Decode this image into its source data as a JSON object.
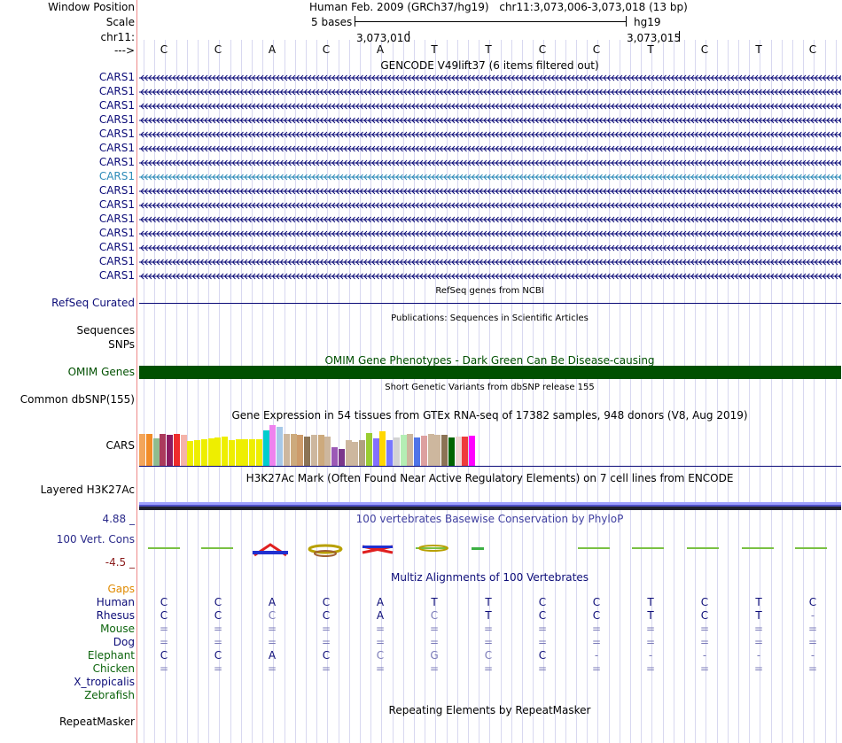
{
  "header": {
    "labels": {
      "window_position": "Window Position",
      "scale": "Scale",
      "chrom": "chr11:",
      "strand": "--->"
    },
    "position_title": "Human Feb. 2009 (GRCh37/hg19)",
    "position_coords": "chr11:3,073,006-3,073,018 (13 bp)",
    "scale_text": "5 bases",
    "assembly": "hg19",
    "coord_left": "3,073,010",
    "coord_right": "3,073,015",
    "bases": [
      "C",
      "C",
      "A",
      "C",
      "A",
      "T",
      "T",
      "C",
      "C",
      "T",
      "C",
      "T",
      "C"
    ]
  },
  "gencode": {
    "title": "GENCODE V49lift37 (6 items filtered out)",
    "transcripts": [
      "CARS1",
      "CARS1",
      "CARS1",
      "CARS1",
      "CARS1",
      "CARS1",
      "CARS1",
      "CARS1",
      "CARS1",
      "CARS1",
      "CARS1",
      "CARS1",
      "CARS1",
      "CARS1",
      "CARS1"
    ],
    "highlight_index": 7,
    "colors": {
      "normal": "#0c0c78",
      "highlight": "#2d8bb8"
    }
  },
  "refseq": {
    "title": "RefSeq genes from NCBI",
    "label": "RefSeq Curated"
  },
  "publications": {
    "title": "Publications: Sequences in Scientific Articles",
    "labels": [
      "Sequences",
      "SNPs"
    ]
  },
  "omim": {
    "title": "OMIM Gene Phenotypes - Dark Green Can Be Disease-causing",
    "label": "OMIM Genes",
    "color": "#005000"
  },
  "dbsnp": {
    "title": "Short Genetic Variants from dbSNP release 155",
    "label": "Common dbSNP(155)"
  },
  "gtex": {
    "title": "Gene Expression in 54 tissues from GTEx RNA-seq of 17382 samples, 948 donors (V8, Aug 2019)",
    "label": "CARS",
    "bar_levels": [
      0.72,
      0.72,
      0.62,
      0.72,
      0.7,
      0.72,
      0.7,
      0.55,
      0.58,
      0.6,
      0.62,
      0.64,
      0.66,
      0.58,
      0.6,
      0.6,
      0.6,
      0.6,
      0.8,
      0.92,
      0.88,
      0.72,
      0.72,
      0.7,
      0.66,
      0.7,
      0.7,
      0.66,
      0.42,
      0.38,
      0.58,
      0.54,
      0.58,
      0.74,
      0.62,
      0.78,
      0.58,
      0.64,
      0.7,
      0.72,
      0.64,
      0.68,
      0.72,
      0.7,
      0.7,
      0.64,
      0.66,
      0.66,
      0.68
    ],
    "bar_colors": [
      "#f3a55a",
      "#f28c28",
      "#8fbc8f",
      "#ab3a5c",
      "#8b1c62",
      "#ee2c2c",
      "#f5b3a9",
      "#eeee00",
      "#eeee00",
      "#eeee00",
      "#eeee00",
      "#eeee00",
      "#eeee00",
      "#eeee00",
      "#eeee00",
      "#eeee00",
      "#eeee00",
      "#eeee00",
      "#00cdcd",
      "#ee82ee",
      "#a6c8e8",
      "#cdb79e",
      "#cdaa7d",
      "#cd9b6b",
      "#8b7355",
      "#cdb79e",
      "#cdaa7d",
      "#cdb79e",
      "#9b59b6",
      "#7a378b",
      "#cdb79e",
      "#cdb79e",
      "#b0a080",
      "#9acd32",
      "#8470ff",
      "#ffd700",
      "#7777ff",
      "#d3d3d3",
      "#b4eeb4",
      "#cdb79e",
      "#4f74e8",
      "#dda0a0",
      "#cdb79e",
      "#cdb79e",
      "#8b7355",
      "#006400",
      "#eed5d2",
      "#ee3b3b",
      "#ff00ff"
    ]
  },
  "h3k27ac": {
    "title": "H3K27Ac Mark (Often Found Near Active Regulatory Elements) on 7 cell lines from ENCODE",
    "label": "Layered H3K27Ac"
  },
  "phylop": {
    "title": "100 vertebrates Basewise Conservation by PhyloP",
    "label": "100 Vert. Cons",
    "max": "4.88 _",
    "min": "-4.5 _"
  },
  "multiz": {
    "title": "Multiz Alignments of 100 Vertebrates",
    "gaps_label": "Gaps",
    "species": [
      {
        "name": "Human",
        "color": "#0c0c78",
        "bases": [
          "C",
          "C",
          "A",
          "C",
          "A",
          "T",
          "T",
          "C",
          "C",
          "T",
          "C",
          "T",
          "C"
        ]
      },
      {
        "name": "Rhesus",
        "color": "#0c0c78",
        "bases": [
          "C",
          "C",
          "C",
          "C",
          "A",
          "C",
          "T",
          "C",
          "C",
          "T",
          "C",
          "T",
          "-"
        ]
      },
      {
        "name": "Mouse",
        "color": "#0c640c",
        "bases": [
          "=",
          "=",
          "=",
          "=",
          "=",
          "=",
          "=",
          "=",
          "=",
          "=",
          "=",
          "=",
          "="
        ]
      },
      {
        "name": "Dog",
        "color": "#0c0c78",
        "bases": [
          "=",
          "=",
          "=",
          "=",
          "=",
          "=",
          "=",
          "=",
          "=",
          "=",
          "=",
          "=",
          "="
        ]
      },
      {
        "name": "Elephant",
        "color": "#0c640c",
        "bases": [
          "C",
          "C",
          "A",
          "C",
          "C",
          "G",
          "C",
          "C",
          "-",
          "-",
          "-",
          "-",
          "-"
        ]
      },
      {
        "name": "Chicken",
        "color": "#0c640c",
        "bases": [
          "=",
          "=",
          "=",
          "=",
          "=",
          "=",
          "=",
          "=",
          "=",
          "=",
          "=",
          "=",
          "="
        ]
      },
      {
        "name": "X_tropicalis",
        "color": "#0c0c78",
        "bases": []
      },
      {
        "name": "Zebrafish",
        "color": "#0c640c",
        "bases": []
      }
    ]
  },
  "repeatmasker": {
    "title": "Repeating Elements by RepeatMasker",
    "label": "RepeatMasker"
  }
}
